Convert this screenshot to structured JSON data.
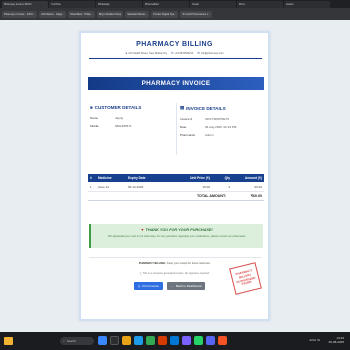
{
  "browser": {
    "tabs": [
      "Pharmacy Invoice #INV2",
      "YouTube",
      "WhatsApp",
      "PharmaMed",
      "Gmail",
      "Drive",
      "Assets",
      "Local"
    ],
    "bookmarks": [
      "Pharmacy Invoice - INVC...",
      "Hill Market - Gilga...",
      "ShareMed - Philip...",
      "Bhye Medikal Shop",
      "Standard Bazar...",
      "Pocket Digital Sys...",
      "Sri Gold Pharmacies v...",
      "Lub/Rank Design Buying",
      "LAT Link Mobile...",
      "Elite Medical..."
    ]
  },
  "invoice": {
    "brand": "PHARMACY BILLING",
    "contact": {
      "address": "123 Health Street, New Dhaka City",
      "phone": "+91 9876543210",
      "email": "info@pharmacy.com"
    },
    "banner": "PHARMACY INVOICE",
    "customer": {
      "heading": "CUSTOMER DETAILS",
      "name_label": "Name",
      "name_value": "Jayraj",
      "mobile_label": "Mobile",
      "mobile_value": "9601480571"
    },
    "details": {
      "heading": "INVOICE DETAILS",
      "invoice_label": "Invoice #",
      "invoice_value": "INV17387870ETX",
      "date_label": "Date",
      "date_value": "06 Aug 2025, 02:23 PM",
      "pharmacist_label": "Pharmacist",
      "pharmacist_value": "Admin"
    },
    "table": {
      "headers": [
        "#",
        "Medicine",
        "Expiry Date",
        "Unit Price (₹)",
        "Qty",
        "Amount (₹)"
      ],
      "rows": [
        [
          "1",
          "Azee 44",
          "05-12-2025",
          "15.00",
          "4",
          "60.00"
        ]
      ],
      "total_label": "TOTAL AMOUNT:",
      "total_value": "₹60.00"
    },
    "thanks": {
      "title": "THANK YOU FOR YOUR PURCHASE!",
      "message": "We appreciate your trust in our pharmacy. For any questions regarding your medications, please consult our pharmacist."
    },
    "footer": {
      "line1_brand": "PHARMACY BILLING",
      "line1_rest": " | Keep your receipt for future reference",
      "line2": "This is a computer generated invoice. No signature required."
    },
    "buttons": {
      "print": "Print Invoice",
      "back": "Back to Dashboard"
    },
    "stamp": [
      "PHARMACY",
      "BILLING",
      "AUTHORIZED",
      "STAMP"
    ]
  },
  "taskbar": {
    "search": "Search",
    "tray": "ENG IN",
    "time": "14:23",
    "date": "06-08-2025"
  },
  "colors": {
    "brand_blue": "#1a3f8a",
    "thanks_green": "#dcefdc",
    "print_button": "#2d6fe0",
    "back_button": "#6c757d",
    "stamp_red": "#d43a3a"
  }
}
